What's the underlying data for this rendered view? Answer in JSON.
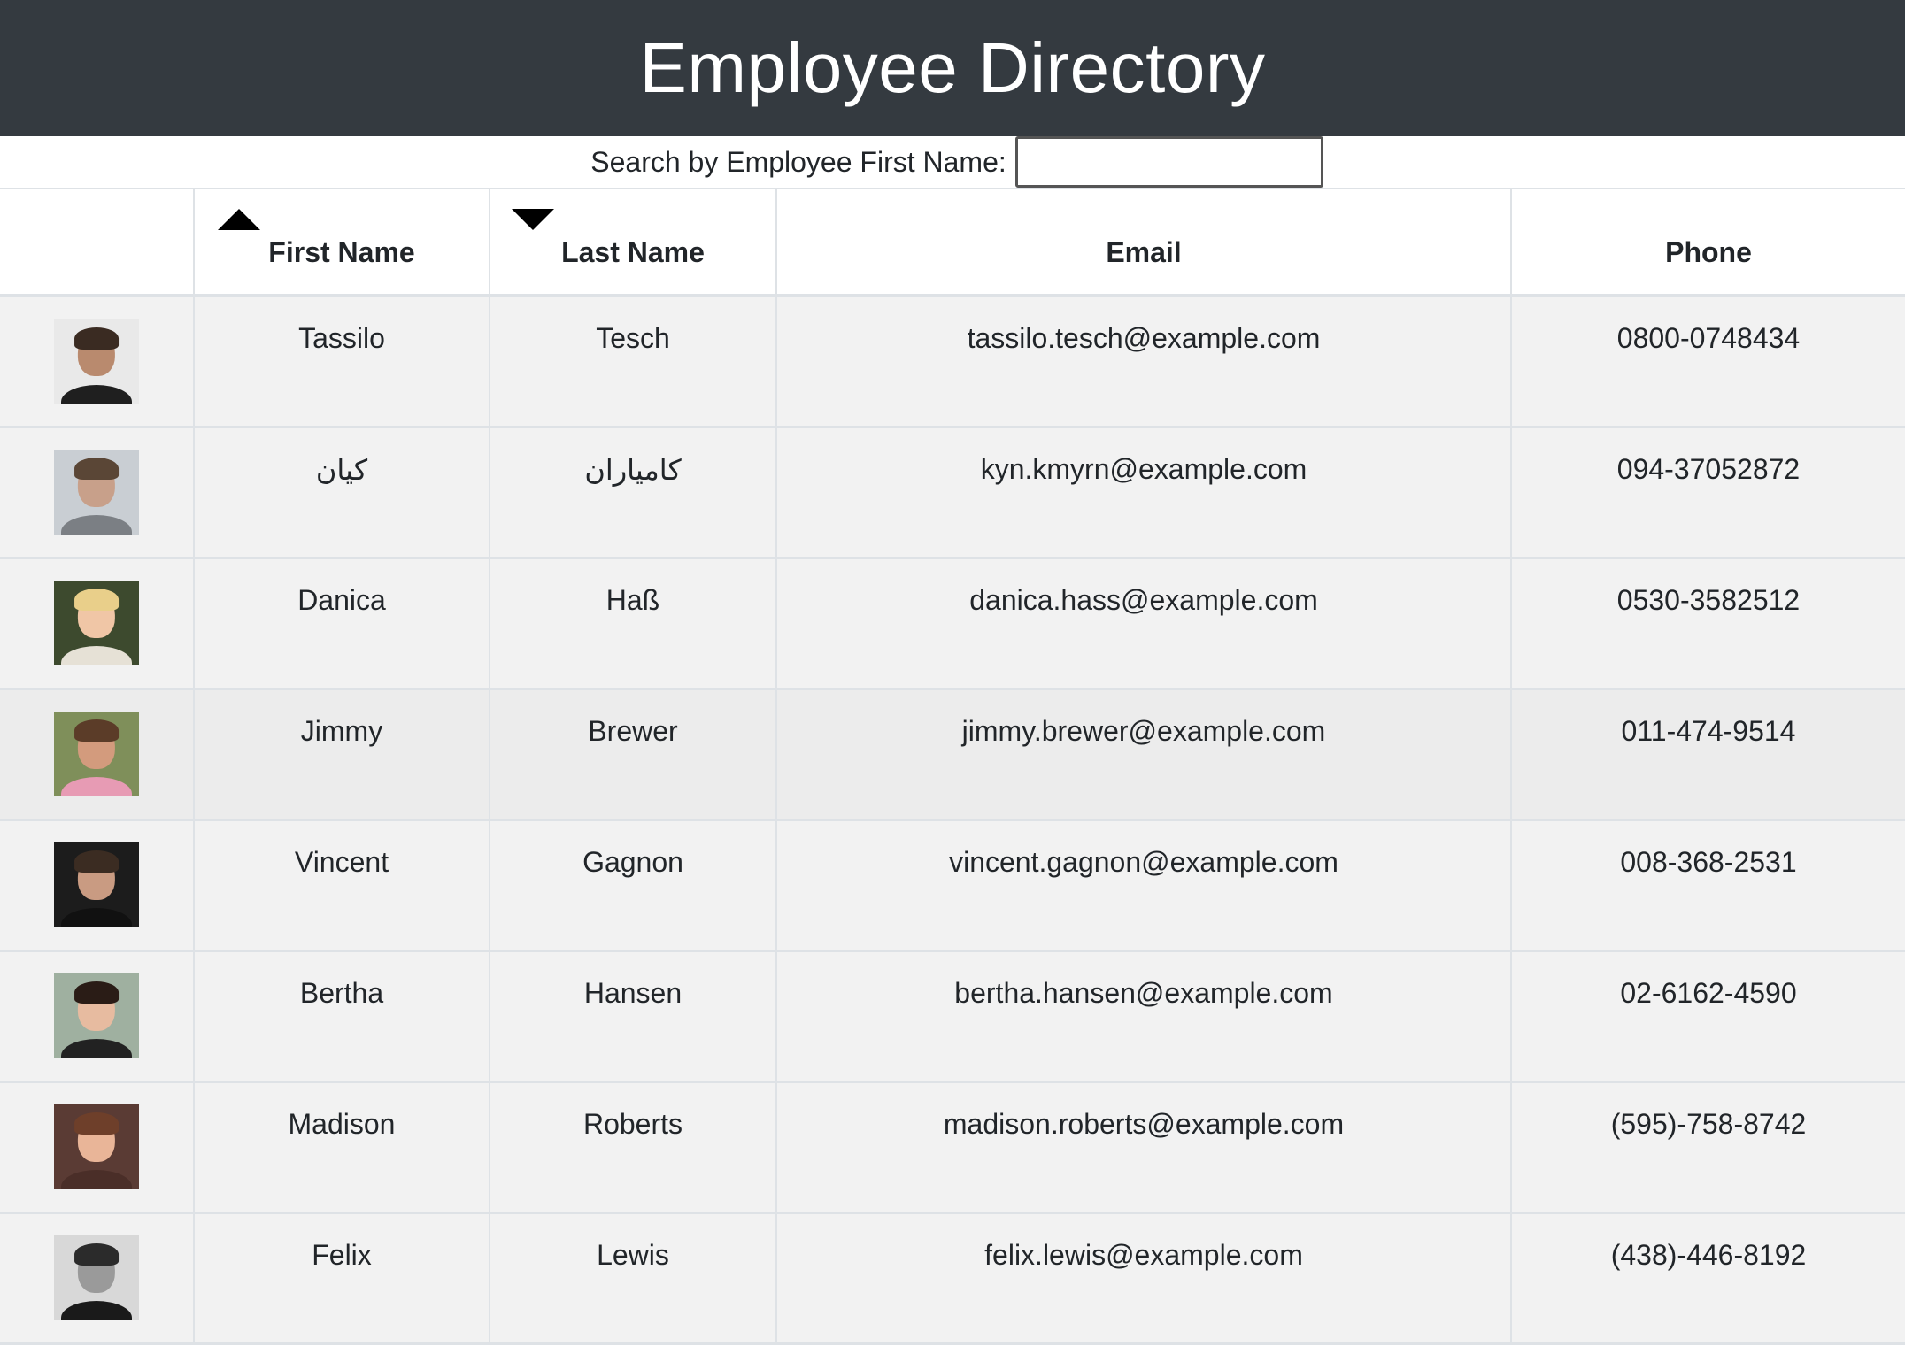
{
  "page": {
    "title": "Employee Directory"
  },
  "search": {
    "label": "Search by Employee First Name:",
    "value": "",
    "placeholder": ""
  },
  "table": {
    "headers": {
      "image": "",
      "first_name": "First Name",
      "last_name": "Last Name",
      "email": "Email",
      "phone": "Phone"
    },
    "sort_icons": {
      "first_name": "sort-ascending-icon",
      "last_name": "sort-descending-icon"
    },
    "rows": [
      {
        "first": "Tassilo",
        "last": "Tesch",
        "email": "tassilo.tesch@example.com",
        "phone": "0800-0748434",
        "avatar": {
          "bg": "#e9e9e9",
          "skin": "#b98a6e",
          "hair": "#3a2b22",
          "shirt": "#1f1f1f"
        }
      },
      {
        "first": "کیان",
        "last": "کامیاران",
        "email": "kyn.kmyrn@example.com",
        "phone": "094-37052872",
        "avatar": {
          "bg": "#c9ced3",
          "skin": "#c8a08a",
          "hair": "#5a4636",
          "shirt": "#7b7f84"
        }
      },
      {
        "first": "Danica",
        "last": "Haß",
        "email": "danica.hass@example.com",
        "phone": "0530-3582512",
        "avatar": {
          "bg": "#3d4a2e",
          "skin": "#f0c6a6",
          "hair": "#e9cf8a",
          "shirt": "#e6e1d6"
        }
      },
      {
        "first": "Jimmy",
        "last": "Brewer",
        "email": "jimmy.brewer@example.com",
        "phone": "011-474-9514",
        "avatar": {
          "bg": "#7f8f5a",
          "skin": "#d39b7d",
          "hair": "#5b3c28",
          "shirt": "#e79bb4"
        }
      },
      {
        "first": "Vincent",
        "last": "Gagnon",
        "email": "vincent.gagnon@example.com",
        "phone": "008-368-2531",
        "avatar": {
          "bg": "#1c1c1c",
          "skin": "#c99b82",
          "hair": "#3b2c22",
          "shirt": "#111111"
        }
      },
      {
        "first": "Bertha",
        "last": "Hansen",
        "email": "bertha.hansen@example.com",
        "phone": "02-6162-4590",
        "avatar": {
          "bg": "#9fb0a0",
          "skin": "#e7bba0",
          "hair": "#2a1c16",
          "shirt": "#222222"
        }
      },
      {
        "first": "Madison",
        "last": "Roberts",
        "email": "madison.roberts@example.com",
        "phone": "(595)-758-8742",
        "avatar": {
          "bg": "#5a3b34",
          "skin": "#e9b598",
          "hair": "#6e3f2a",
          "shirt": "#4a2e28"
        }
      },
      {
        "first": "Felix",
        "last": "Lewis",
        "email": "felix.lewis@example.com",
        "phone": "(438)-446-8192",
        "avatar": {
          "bg": "#d8d8d8",
          "skin": "#9a9a9a",
          "hair": "#2b2b2b",
          "shirt": "#1a1a1a"
        }
      }
    ]
  },
  "colors": {
    "header_bg": "#343a40",
    "header_text": "#ffffff",
    "row_bg": "#f2f2f2",
    "row_hover_bg": "#ececec",
    "border": "#dee2e6"
  }
}
